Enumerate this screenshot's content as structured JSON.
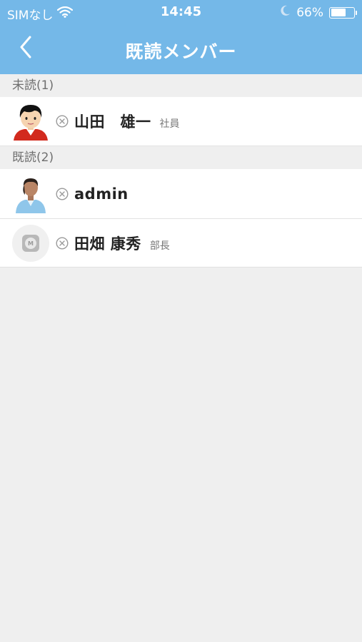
{
  "status_bar": {
    "carrier": "SIMなし",
    "time": "14:45",
    "battery_percent_label": "66%",
    "battery_level": 0.66,
    "icons": [
      "wifi-icon",
      "moon-icon",
      "battery-icon"
    ]
  },
  "nav": {
    "title": "既読メンバー",
    "back_icon": "chevron-left-icon"
  },
  "sections": {
    "unread": {
      "header": "未読(1)",
      "members": [
        {
          "name": "山田　雄一",
          "title": "社員",
          "avatar": "red-shirt-avatar",
          "status_icon": "close-circle-icon"
        }
      ]
    },
    "read": {
      "header": "既読(2)",
      "members": [
        {
          "name": "admin",
          "title": "",
          "avatar": "man-avatar",
          "status_icon": "close-circle-icon"
        },
        {
          "name": "田畑 康秀",
          "title": "部長",
          "avatar": "default-avatar",
          "status_icon": "close-circle-icon"
        }
      ]
    }
  },
  "colors": {
    "header_bg": "#74b8e8",
    "page_bg": "#efefef",
    "row_bg": "#ffffff"
  }
}
